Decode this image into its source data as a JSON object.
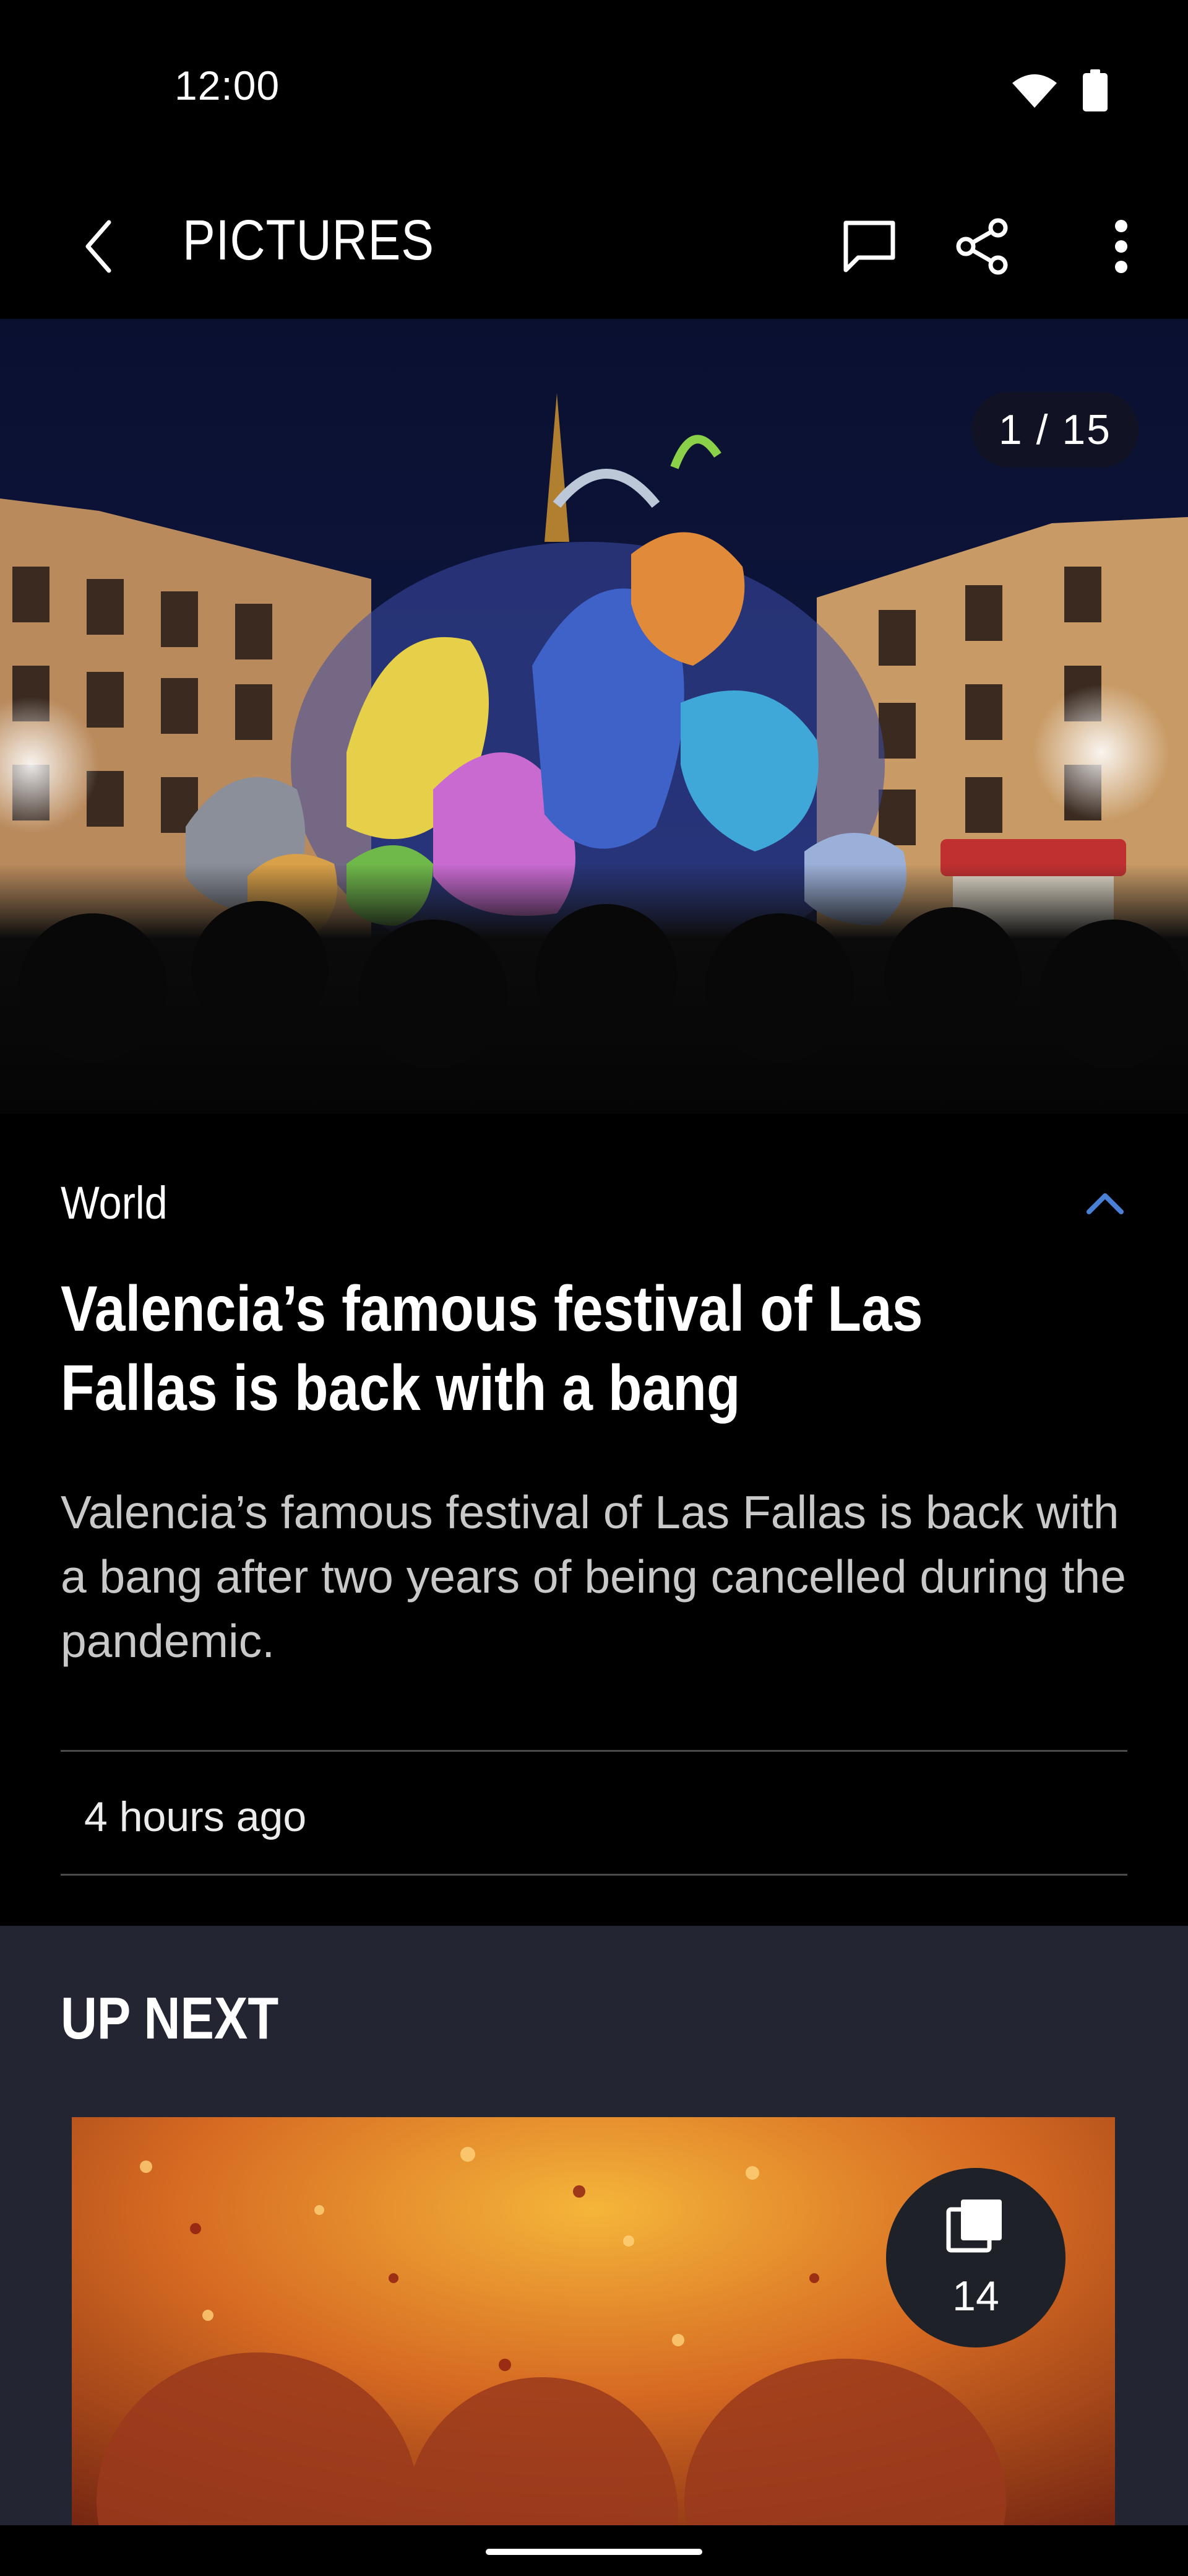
{
  "status_bar": {
    "time": "12:00",
    "icons": [
      "wifi-icon",
      "battery-icon"
    ]
  },
  "app_bar": {
    "title": "PICTURES",
    "back_icon": "chevron-left-icon",
    "actions": [
      "comment-icon",
      "share-icon",
      "more-vert-icon"
    ]
  },
  "gallery": {
    "counter": "1 / 15"
  },
  "article": {
    "category": "World",
    "collapse_icon": "chevron-up-icon",
    "headline": "Valencia’s famous festival of Las Fallas is back with a bang",
    "summary": "Valencia’s famous festival of Las Fallas is back with a bang after two years of being cancelled during the pandemic.",
    "timestamp": "4 hours ago"
  },
  "up_next": {
    "title": "UP NEXT",
    "card": {
      "gallery_icon": "gallery-stack-icon",
      "count": "14"
    }
  },
  "colors": {
    "accent": "#4a7fd6",
    "background": "#000000",
    "panel": "#232632"
  }
}
